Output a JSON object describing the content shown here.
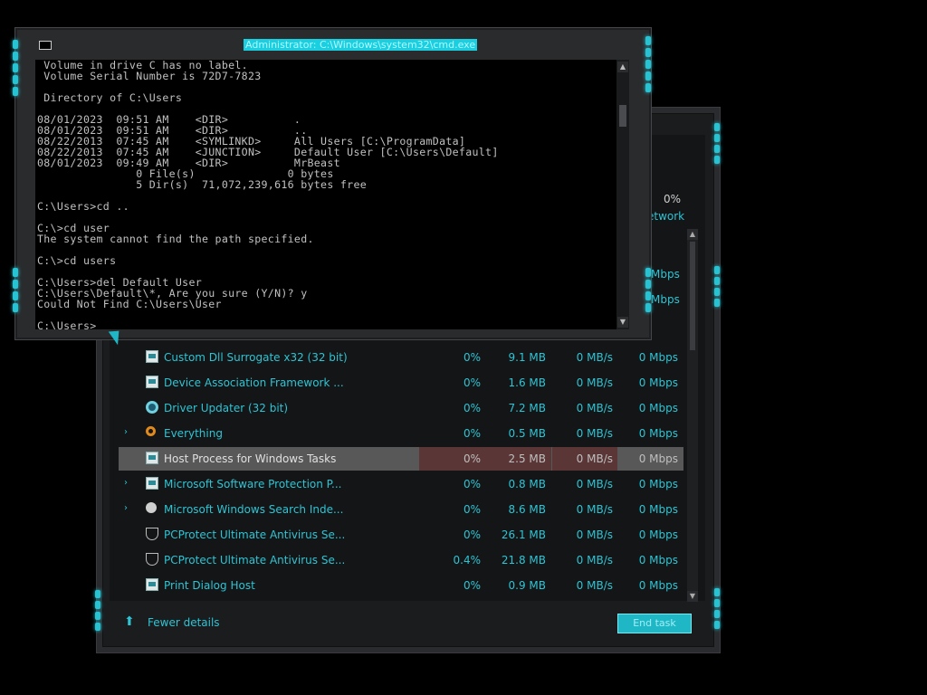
{
  "cmd": {
    "title": "Administrator: C:\\Windows\\system32\\cmd.exe",
    "lines": [
      " Volume in drive C has no label.",
      " Volume Serial Number is 72D7-7823",
      "",
      " Directory of C:\\Users",
      "",
      "08/01/2023  09:51 AM    <DIR>          .",
      "08/01/2023  09:51 AM    <DIR>          ..",
      "08/22/2013  07:45 AM    <SYMLINKD>     All Users [C:\\ProgramData]",
      "08/22/2013  07:45 AM    <JUNCTION>     Default User [C:\\Users\\Default]",
      "08/01/2023  09:49 AM    <DIR>          MrBeast",
      "               0 File(s)              0 bytes",
      "               5 Dir(s)  71,072,239,616 bytes free",
      "",
      "C:\\Users>cd ..",
      "",
      "C:\\>cd user",
      "The system cannot find the path specified.",
      "",
      "C:\\>cd users",
      "",
      "C:\\Users>del Default User",
      "C:\\Users\\Default\\*, Are you sure (Y/N)? y",
      "Could Not Find C:\\Users\\User",
      "",
      "C:\\Users>"
    ]
  },
  "taskmgr": {
    "header_cpu_pct": "0%",
    "header_network": "etwork",
    "partial_rows": [
      {
        "network": "Mbps"
      },
      {
        "network": "Mbps"
      }
    ],
    "rows": [
      {
        "name": "Custom Dll Surrogate x32 (32 bit)",
        "cpu": "0%",
        "memory": "9.1 MB",
        "disk": "0 MB/s",
        "network": "0 Mbps",
        "icon": "app-window-icon",
        "expandable": false
      },
      {
        "name": "Device Association Framework ...",
        "cpu": "0%",
        "memory": "1.6 MB",
        "disk": "0 MB/s",
        "network": "0 Mbps",
        "icon": "app-window-icon",
        "expandable": false
      },
      {
        "name": "Driver Updater (32 bit)",
        "cpu": "0%",
        "memory": "7.2 MB",
        "disk": "0 MB/s",
        "network": "0 Mbps",
        "icon": "gear-icon",
        "expandable": false
      },
      {
        "name": "Everything",
        "cpu": "0%",
        "memory": "0.5 MB",
        "disk": "0 MB/s",
        "network": "0 Mbps",
        "icon": "search-icon",
        "expandable": true
      },
      {
        "name": "Host Process for Windows Tasks",
        "cpu": "0%",
        "memory": "2.5 MB",
        "disk": "0 MB/s",
        "network": "0 Mbps",
        "icon": "app-window-icon",
        "expandable": false,
        "selected": true
      },
      {
        "name": "Microsoft Software Protection P...",
        "cpu": "0%",
        "memory": "0.8 MB",
        "disk": "0 MB/s",
        "network": "0 Mbps",
        "icon": "app-window-icon",
        "expandable": true
      },
      {
        "name": "Microsoft Windows Search Inde...",
        "cpu": "0%",
        "memory": "8.6 MB",
        "disk": "0 MB/s",
        "network": "0 Mbps",
        "icon": "user-icon",
        "expandable": true
      },
      {
        "name": "PCProtect Ultimate Antivirus Se...",
        "cpu": "0%",
        "memory": "26.1 MB",
        "disk": "0 MB/s",
        "network": "0 Mbps",
        "icon": "shield-icon",
        "expandable": false
      },
      {
        "name": "PCProtect Ultimate Antivirus Se...",
        "cpu": "0.4%",
        "memory": "21.8 MB",
        "disk": "0 MB/s",
        "network": "0 Mbps",
        "icon": "shield-icon",
        "expandable": false
      },
      {
        "name": "Print Dialog Host",
        "cpu": "0%",
        "memory": "0.9 MB",
        "disk": "0 MB/s",
        "network": "0 Mbps",
        "icon": "app-window-icon",
        "expandable": false
      }
    ],
    "fewer_details_label": "Fewer details",
    "end_task_label": "End task"
  },
  "colors": {
    "accent": "#1fb6c6",
    "text_cyan": "#2ec4d4",
    "console_bg": "#000000",
    "console_fg": "#c0c0c0",
    "selected_row": "#585858"
  }
}
